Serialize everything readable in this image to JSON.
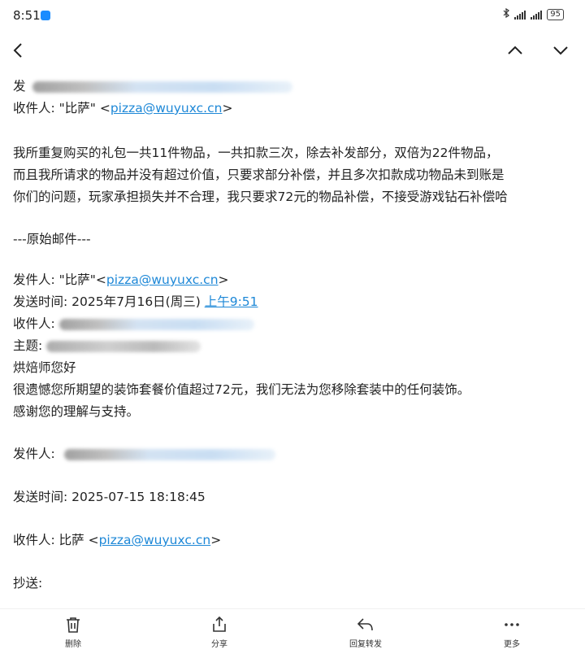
{
  "status": {
    "time": "8:51",
    "battery": "95"
  },
  "toolbar": {
    "back": "back",
    "prev": "previous",
    "next": "next"
  },
  "email": {
    "line_from_top": "发",
    "to_prefix": "收件人: \"比萨\" <",
    "to_email": "pizza@wuyuxc.cn",
    "to_suffix": ">",
    "body_1": "我所重复购买的礼包一共11件物品，一共扣款三次，除去补发部分，双倍为22件物品，",
    "body_2": "而且我所请求的物品并没有超过价值，只要求部分补偿，并且多次扣款成功物品未到账是",
    "body_3": "你们的问题，玩家承担损失并不合理，我只要求72元的物品补偿，不接受游戏钻石补偿哈",
    "original_header": "---原始邮件---",
    "orig_from_prefix": "发件人: \"比萨\"<",
    "orig_from_email": "pizza@wuyuxc.cn",
    "orig_from_suffix": ">",
    "orig_sent_prefix": "发送时间: 2025年7月16日(周三) ",
    "orig_sent_time": "上午9:51",
    "orig_to_label": "收件人: ",
    "orig_subject_label": "主题:",
    "greeting": "烘焙师您好",
    "reply_1": "很遗憾您所期望的装饰套餐价值超过72元，我们无法为您移除套装中的任何装饰。",
    "reply_2": "感谢您的理解与支持。",
    "from2_label": "发件人:",
    "sent2": "发送时间:  2025-07-15 18:18:45",
    "to2_prefix": "收件人:  比萨 <",
    "to2_email": "pizza@wuyuxc.cn",
    "to2_suffix": ">",
    "cc_label": "抄送:"
  },
  "bottom": {
    "delete": "删除",
    "share": "分享",
    "reply_forward": "回复转发",
    "more": "更多"
  }
}
